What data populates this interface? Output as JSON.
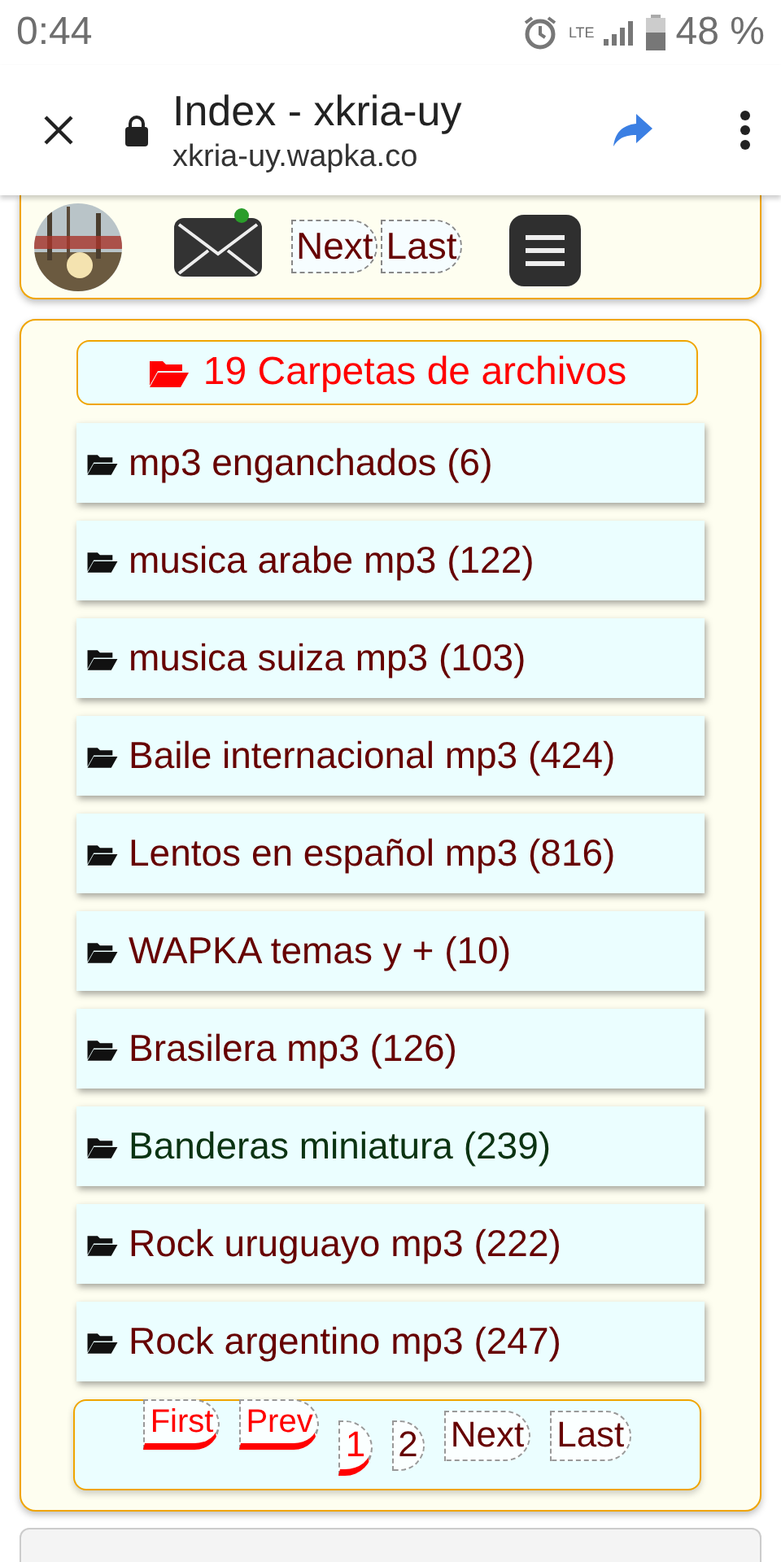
{
  "status_bar": {
    "time": "0:44",
    "network": "LTE",
    "battery": "48 %"
  },
  "browser": {
    "title": "Index - xkria-uy",
    "url": "xkria-uy.wapka.co"
  },
  "top_card": {
    "mail_unread": true,
    "links": [
      "Next",
      "Last"
    ]
  },
  "folders": {
    "header": "19 Carpetas de archivos",
    "items": [
      {
        "label": "mp3 enganchados (6)",
        "color": "#660000"
      },
      {
        "label": "musica arabe mp3 (122)",
        "color": "#660000"
      },
      {
        "label": "musica suiza mp3 (103)",
        "color": "#660000"
      },
      {
        "label": "Baile internacional mp3 (424)",
        "color": "#660000"
      },
      {
        "label": "Lentos en español mp3 (816)",
        "color": "#660000"
      },
      {
        "label": "WAPKA temas y + (10)",
        "color": "#660000"
      },
      {
        "label": "Brasilera mp3 (126)",
        "color": "#660000"
      },
      {
        "label": "Banderas miniatura (239)",
        "color": "#0b3312"
      },
      {
        "label": "Rock uruguayo mp3 (222)",
        "color": "#660000"
      },
      {
        "label": "Rock argentino mp3 (247)",
        "color": "#660000"
      }
    ],
    "pagination": {
      "nav": [
        {
          "label": "First",
          "disabled": true
        },
        {
          "label": "Prev",
          "disabled": true
        }
      ],
      "pages": [
        {
          "label": "1",
          "selected": true
        },
        {
          "label": "2",
          "selected": false
        }
      ],
      "links": [
        "Next",
        "Last"
      ]
    }
  }
}
